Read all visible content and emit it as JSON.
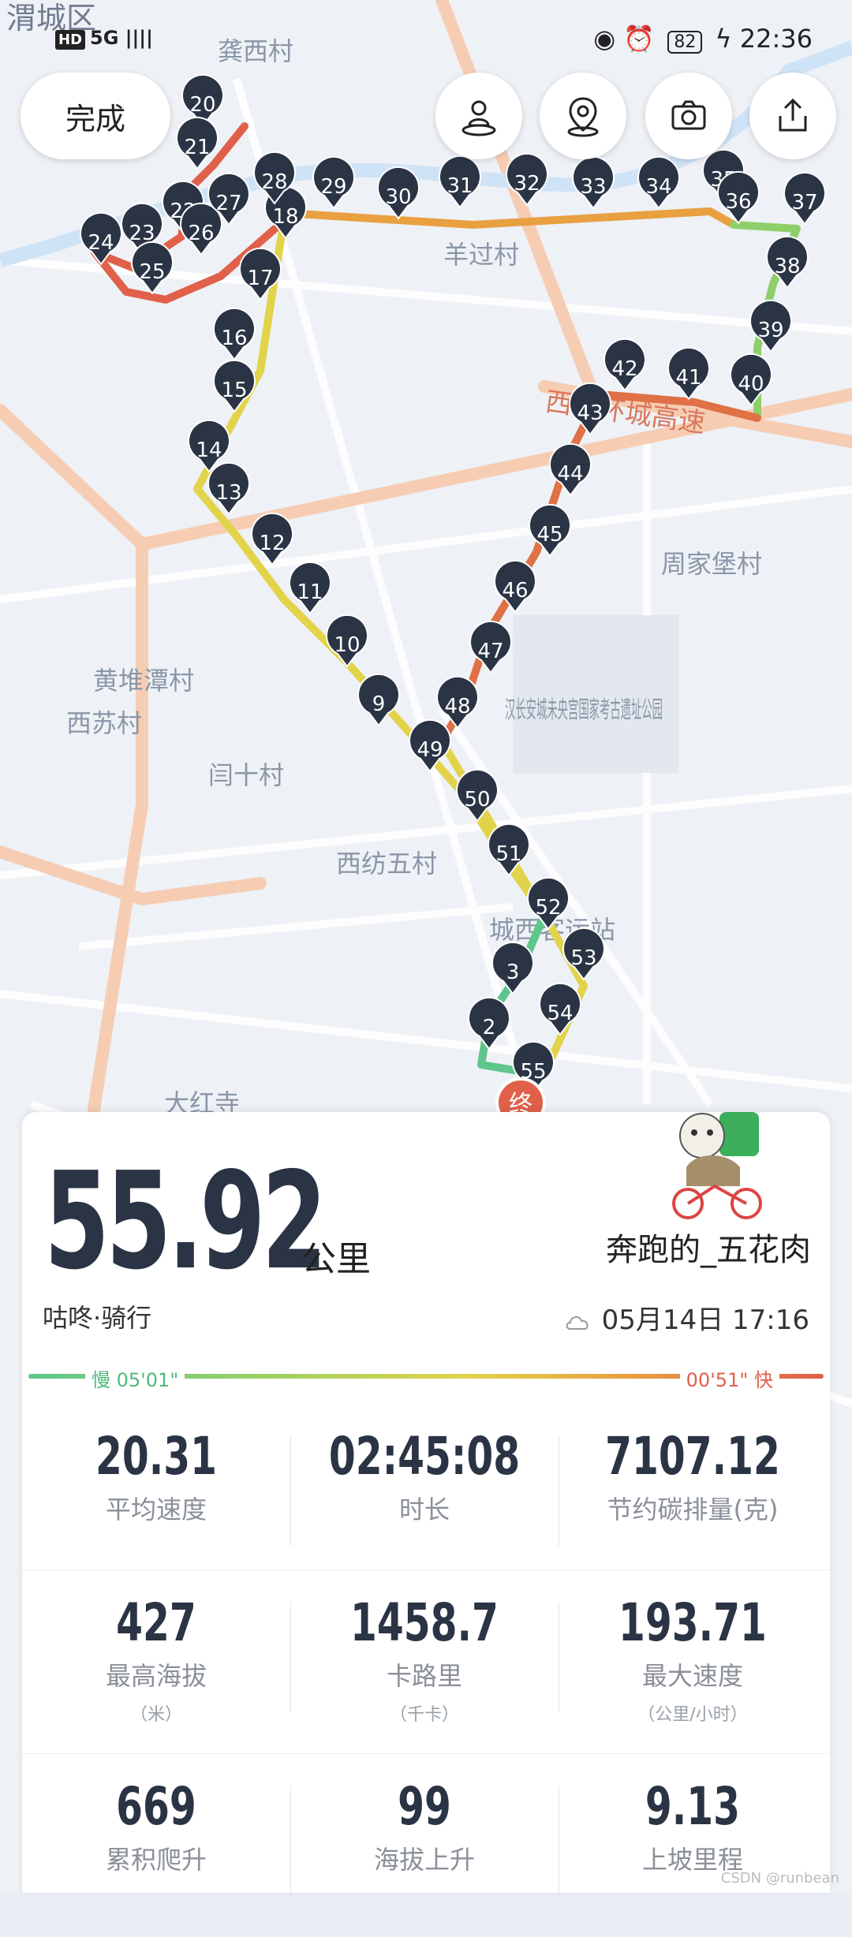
{
  "status_bar": {
    "left": "5G ||||",
    "hd": "HD",
    "battery": "82",
    "time": "22:36"
  },
  "toolbar": {
    "done_label": "完成",
    "icons": [
      "person-pin-icon",
      "location-pin-icon",
      "camera-icon",
      "share-icon"
    ]
  },
  "map": {
    "labels": [
      "渭城区",
      "龚西村",
      "羊过村",
      "周家堡村",
      "黄堆潭村",
      "西苏村",
      "闫十村",
      "汉长安城未央宫国家考古遗址公园",
      "西纺五村",
      "城西客运站",
      "大红寺",
      "西三环城高速"
    ],
    "markers": [
      "2",
      "3",
      "9",
      "10",
      "11",
      "12",
      "13",
      "14",
      "15",
      "16",
      "17",
      "18",
      "20",
      "21",
      "22",
      "23",
      "24",
      "25",
      "26",
      "27",
      "28",
      "29",
      "30",
      "31",
      "32",
      "33",
      "34",
      "35",
      "36",
      "37",
      "38",
      "39",
      "40",
      "41",
      "42",
      "43",
      "44",
      "45",
      "46",
      "47",
      "48",
      "49",
      "50",
      "51",
      "52",
      "53",
      "54",
      "55"
    ],
    "end_marker": "终",
    "colors": {
      "slow": "#5ec68a",
      "mid": "#e2d34a",
      "fast": "#e0604a",
      "pin": "#2b3445"
    }
  },
  "summary": {
    "distance": "55.92",
    "distance_unit": "公里",
    "user_name": "奔跑的_五花肉",
    "sport": "咕咚·骑行",
    "datetime": "05月14日 17:16",
    "slow_pace": "慢 05'01\"",
    "fast_pace": "00'51\" 快"
  },
  "stats": [
    [
      {
        "value": "20.31",
        "label": "平均速度",
        "sub": ""
      },
      {
        "value": "02:45:08",
        "label": "时长",
        "sub": ""
      },
      {
        "value": "7107.12",
        "label": "节约碳排量(克)",
        "sub": ""
      }
    ],
    [
      {
        "value": "427",
        "label": "最高海拔",
        "sub": "（米）"
      },
      {
        "value": "1458.7",
        "label": "卡路里",
        "sub": "（千卡）"
      },
      {
        "value": "193.71",
        "label": "最大速度",
        "sub": "（公里/小时）"
      }
    ],
    [
      {
        "value": "669",
        "label": "累积爬升",
        "sub": ""
      },
      {
        "value": "99",
        "label": "海拔上升",
        "sub": ""
      },
      {
        "value": "9.13",
        "label": "上坡里程",
        "sub": ""
      }
    ]
  ],
  "watermark": "CSDN @runbean"
}
